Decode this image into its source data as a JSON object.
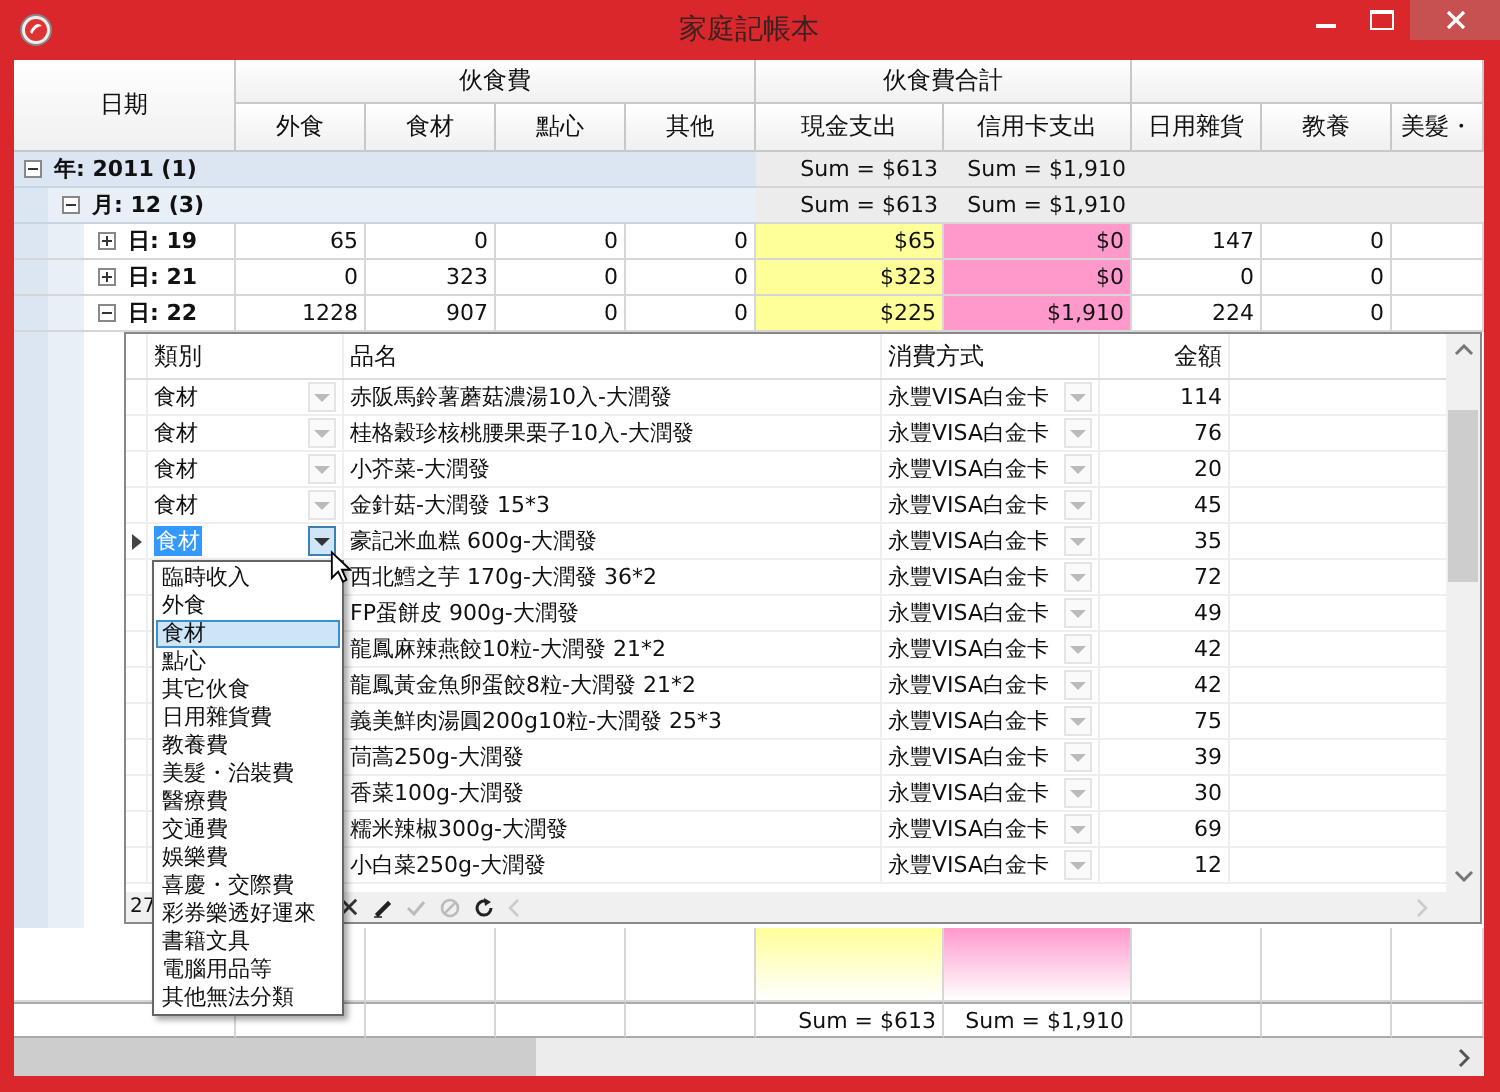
{
  "window": {
    "title": "家庭記帳本"
  },
  "date_column": "日期",
  "column_groups": [
    {
      "label": "伙食費",
      "columns": [
        "外食",
        "食材",
        "點心",
        "其他"
      ]
    },
    {
      "label": "伙食費合計",
      "columns": [
        "現金支出",
        "信用卡支出"
      ]
    },
    {
      "columns": [
        "日用雜貨",
        "教養",
        "美髮・"
      ]
    }
  ],
  "groups": [
    {
      "kind": "year",
      "label": "年: 2011 (1)",
      "expanded": true,
      "cash_sum": "Sum = $613",
      "credit_sum": "Sum = $1,910"
    },
    {
      "kind": "month",
      "label": "月: 12 (3)",
      "expanded": true,
      "cash_sum": "Sum = $613",
      "credit_sum": "Sum = $1,910"
    }
  ],
  "days": [
    {
      "label": "日: 19",
      "expanded": false,
      "values": [
        "65",
        "0",
        "0",
        "0",
        "$65",
        "$0",
        "147",
        "0"
      ]
    },
    {
      "label": "日: 21",
      "expanded": false,
      "values": [
        "0",
        "323",
        "0",
        "0",
        "$323",
        "$0",
        "0",
        "0"
      ]
    },
    {
      "label": "日: 22",
      "expanded": true,
      "values": [
        "1228",
        "907",
        "0",
        "0",
        "$225",
        "$1,910",
        "224",
        "0"
      ]
    }
  ],
  "detail": {
    "columns": [
      "類別",
      "品名",
      "消費方式",
      "金額"
    ],
    "record_count": "27",
    "rows": [
      {
        "category": "食材",
        "name": "赤阪馬鈴薯蘑菇濃湯10入-大潤發",
        "payment": "永豐VISA白金卡",
        "amount": "114",
        "selected": false
      },
      {
        "category": "食材",
        "name": "桂格穀珍核桃腰果栗子10入-大潤發",
        "payment": "永豐VISA白金卡",
        "amount": "76",
        "selected": false
      },
      {
        "category": "食材",
        "name": "小芥菜-大潤發",
        "payment": "永豐VISA白金卡",
        "amount": "20",
        "selected": false
      },
      {
        "category": "食材",
        "name": "金針菇-大潤發 15*3",
        "payment": "永豐VISA白金卡",
        "amount": "45",
        "selected": false
      },
      {
        "category": "食材",
        "name": "豪記米血糕 600g-大潤發",
        "payment": "永豐VISA白金卡",
        "amount": "35",
        "selected": true
      },
      {
        "name": "西北鱈之芋 170g-大潤發 36*2",
        "payment": "永豐VISA白金卡",
        "amount": "72",
        "selected": false
      },
      {
        "name": "FP蛋餅皮 900g-大潤發",
        "payment": "永豐VISA白金卡",
        "amount": "49",
        "selected": false
      },
      {
        "name": "龍鳳麻辣燕餃10粒-大潤發 21*2",
        "payment": "永豐VISA白金卡",
        "amount": "42",
        "selected": false
      },
      {
        "name": "龍鳳黃金魚卵蛋餃8粒-大潤發 21*2",
        "payment": "永豐VISA白金卡",
        "amount": "42",
        "selected": false
      },
      {
        "name": "義美鮮肉湯圓200g10粒-大潤發 25*3",
        "payment": "永豐VISA白金卡",
        "amount": "75",
        "selected": false
      },
      {
        "name": "茼蒿250g-大潤發",
        "payment": "永豐VISA白金卡",
        "amount": "39",
        "selected": false
      },
      {
        "name": "香菜100g-大潤發",
        "payment": "永豐VISA白金卡",
        "amount": "30",
        "selected": false
      },
      {
        "name": "糯米辣椒300g-大潤發",
        "payment": "永豐VISA白金卡",
        "amount": "69",
        "selected": false
      },
      {
        "name": "小白菜250g-大潤發",
        "payment": "永豐VISA白金卡",
        "amount": "12",
        "selected": false
      }
    ]
  },
  "dropdown": {
    "items": [
      {
        "label": "臨時收入",
        "selected": false
      },
      {
        "label": "外食",
        "selected": false
      },
      {
        "label": "食材",
        "selected": true
      },
      {
        "label": "點心",
        "selected": false
      },
      {
        "label": "其它伙食",
        "selected": false
      },
      {
        "label": "日用雜貨費",
        "selected": false
      },
      {
        "label": "教養費",
        "selected": false
      },
      {
        "label": "美髮・治裝費",
        "selected": false
      },
      {
        "label": "醫療費",
        "selected": false
      },
      {
        "label": "交通費",
        "selected": false
      },
      {
        "label": "娛樂費",
        "selected": false
      },
      {
        "label": "喜慶・交際費",
        "selected": false
      },
      {
        "label": "彩券樂透好運來",
        "selected": false
      },
      {
        "label": "書籍文具",
        "selected": false
      },
      {
        "label": "電腦用品等",
        "selected": false
      },
      {
        "label": "其他無法分類",
        "selected": false
      }
    ]
  },
  "footer": {
    "cash_sum": "Sum = $613",
    "credit_sum": "Sum = $1,910"
  }
}
